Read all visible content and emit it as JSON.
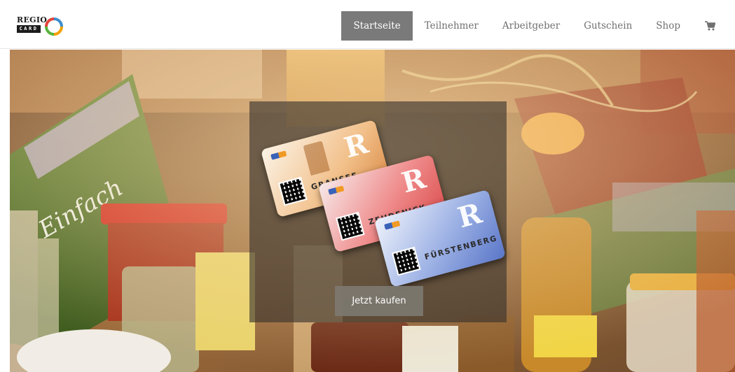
{
  "header": {
    "logo": {
      "top_text": "REGIO",
      "bottom_text": "CARD",
      "ring_colors": [
        "#3c8dcc",
        "#f2a100",
        "#58b33c",
        "#e2443a"
      ]
    },
    "nav": [
      {
        "label": "Startseite",
        "active": true
      },
      {
        "label": "Teilnehmer",
        "active": false
      },
      {
        "label": "Arbeitgeber",
        "active": false
      },
      {
        "label": "Gutschein",
        "active": false
      },
      {
        "label": "Shop",
        "active": false
      }
    ],
    "cart_icon": "shopping-cart-icon"
  },
  "hero": {
    "cards": [
      {
        "name": "GRANSEE",
        "mark": "R"
      },
      {
        "name": "ZEHDENICK",
        "mark": "R"
      },
      {
        "name": "FÜRSTENBERG",
        "mark": "R"
      }
    ],
    "cta_label": "Jetzt kaufen"
  },
  "colors": {
    "nav_active_bg": "#7a7a7a",
    "nav_text": "#707070",
    "overlay": "#37322d",
    "cta_bg": "#7d7870"
  }
}
